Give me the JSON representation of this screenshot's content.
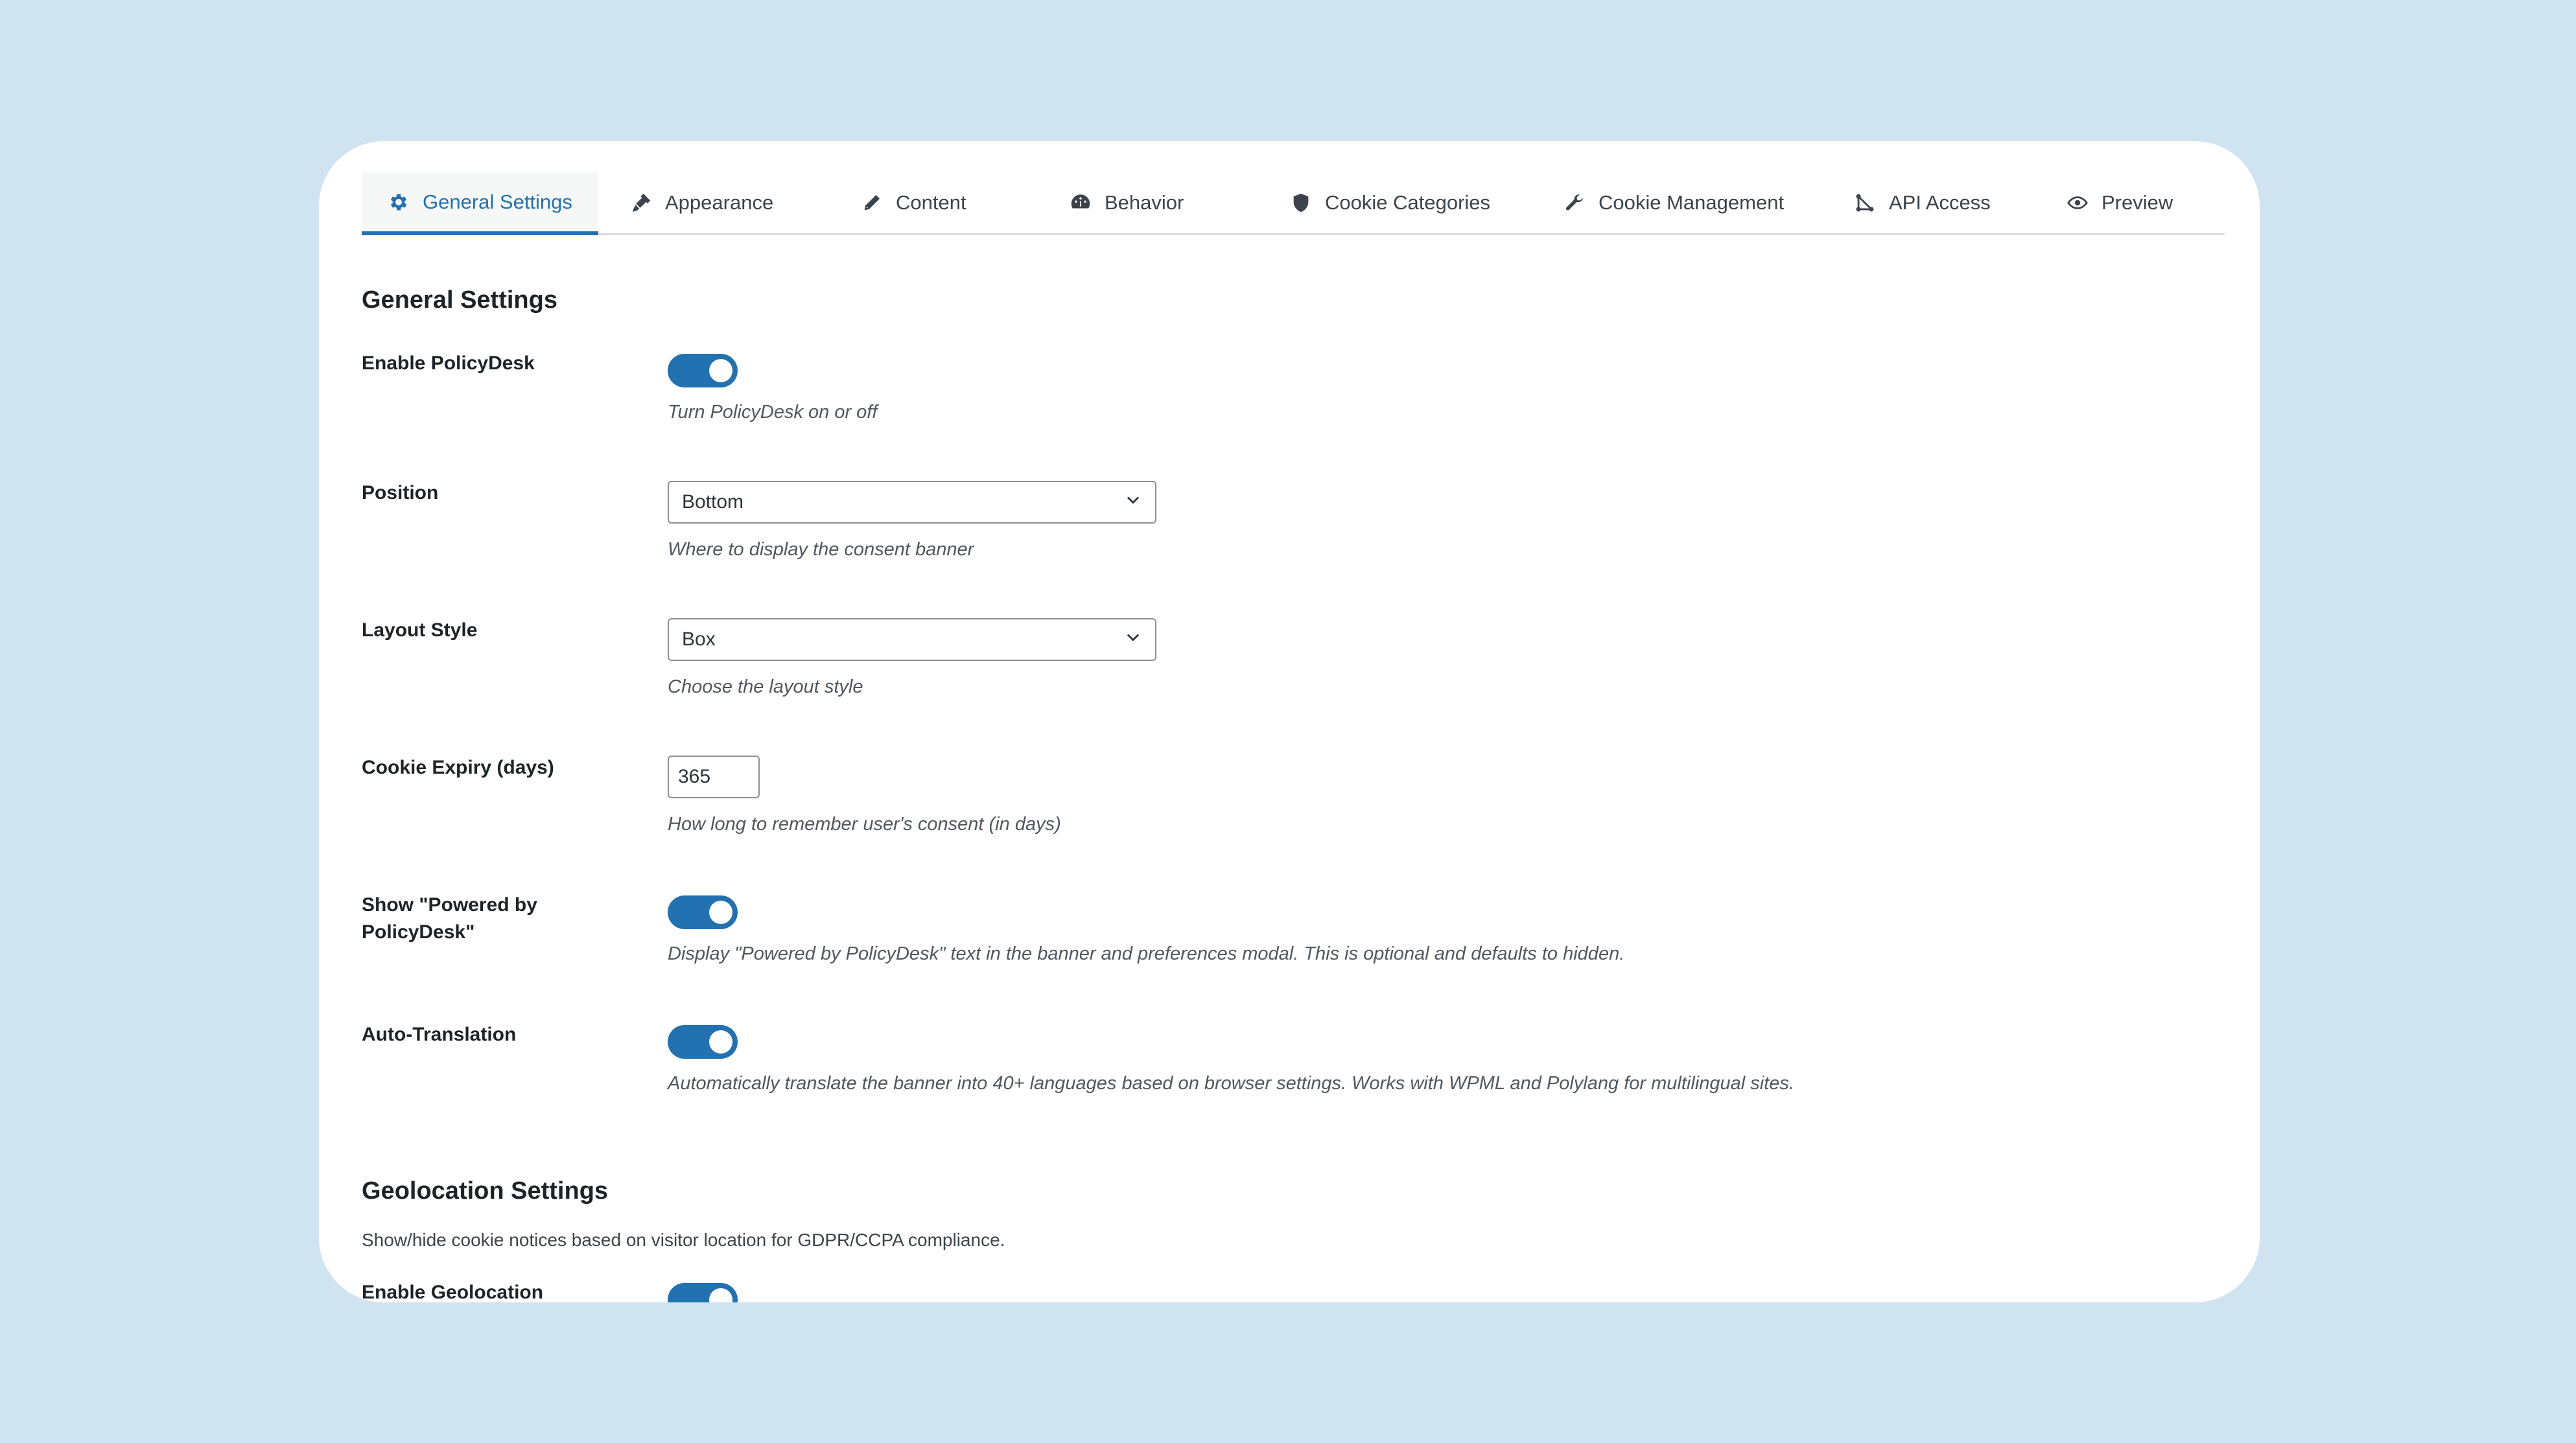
{
  "tabs": [
    {
      "label": "General Settings",
      "icon": "gear-icon",
      "active": true
    },
    {
      "label": "Appearance",
      "icon": "paintbrush-icon"
    },
    {
      "label": "Content",
      "icon": "pencil-icon"
    },
    {
      "label": "Behavior",
      "icon": "dashboard-icon"
    },
    {
      "label": "Cookie Categories",
      "icon": "shield-icon"
    },
    {
      "label": "Cookie Management",
      "icon": "wrench-icon"
    },
    {
      "label": "API Access",
      "icon": "api-icon"
    },
    {
      "label": "Preview",
      "icon": "eye-icon"
    }
  ],
  "general": {
    "title": "General Settings",
    "enable": {
      "label": "Enable PolicyDesk",
      "checked": true,
      "description": "Turn PolicyDesk on or off"
    },
    "position": {
      "label": "Position",
      "value": "Bottom",
      "description": "Where to display the consent banner"
    },
    "layout": {
      "label": "Layout Style",
      "value": "Box",
      "description": "Choose the layout style"
    },
    "expiry": {
      "label": "Cookie Expiry (days)",
      "value": "365",
      "description": "How long to remember user's consent (in days)"
    },
    "powered": {
      "label": "Show \"Powered by PolicyDesk\"",
      "checked": true,
      "description": "Display \"Powered by PolicyDesk\" text in the banner and preferences modal. This is optional and defaults to hidden."
    },
    "translation": {
      "label": "Auto-Translation",
      "checked": true,
      "description": "Automatically translate the banner into 40+ languages based on browser settings. Works with WPML and Polylang for multilingual sites."
    }
  },
  "geo": {
    "title": "Geolocation Settings",
    "description": "Show/hide cookie notices based on visitor location for GDPR/CCPA compliance.",
    "detection": {
      "label": "Enable Geolocation Detection",
      "checked": true
    }
  },
  "colors": {
    "accent": "#2271b1",
    "background": "#d0e3f0",
    "panel": "#ffffff"
  }
}
